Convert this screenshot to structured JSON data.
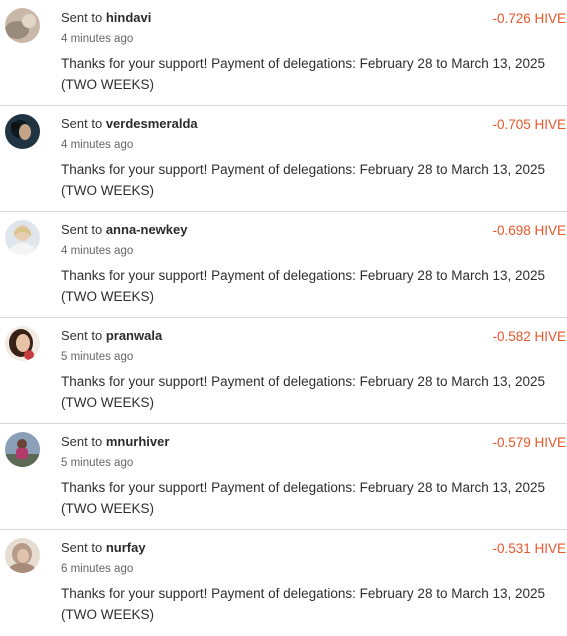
{
  "transfers": [
    {
      "prefix": "Sent to",
      "user": "hindavi",
      "time": "4 minutes ago",
      "memo": "Thanks for your support! Payment of delegations: February 28 to March 13, 2025 (TWO WEEKS)",
      "amount": "-0.726 HIVE",
      "avatar_icon": "user-avatar-icon"
    },
    {
      "prefix": "Sent to",
      "user": "verdesmeralda",
      "time": "4 minutes ago",
      "memo": "Thanks for your support! Payment of delegations: February 28 to March 13, 2025 (TWO WEEKS)",
      "amount": "-0.705 HIVE",
      "avatar_icon": "user-avatar-icon"
    },
    {
      "prefix": "Sent to",
      "user": "anna-newkey",
      "time": "4 minutes ago",
      "memo": "Thanks for your support! Payment of delegations: February 28 to March 13, 2025 (TWO WEEKS)",
      "amount": "-0.698 HIVE",
      "avatar_icon": "user-avatar-icon"
    },
    {
      "prefix": "Sent to",
      "user": "pranwala",
      "time": "5 minutes ago",
      "memo": "Thanks for your support! Payment of delegations: February 28 to March 13, 2025 (TWO WEEKS)",
      "amount": "-0.582 HIVE",
      "avatar_icon": "user-avatar-icon"
    },
    {
      "prefix": "Sent to",
      "user": "mnurhiver",
      "time": "5 minutes ago",
      "memo": "Thanks for your support! Payment of delegations: February 28 to March 13, 2025 (TWO WEEKS)",
      "amount": "-0.579 HIVE",
      "avatar_icon": "user-avatar-icon"
    },
    {
      "prefix": "Sent to",
      "user": "nurfay",
      "time": "6 minutes ago",
      "memo": "Thanks for your support! Payment of delegations: February 28 to March 13, 2025 (TWO WEEKS)",
      "amount": "-0.531 HIVE",
      "avatar_icon": "user-avatar-icon"
    }
  ],
  "colors": {
    "amount": "#e8562a",
    "divider": "#d6d6d6"
  }
}
